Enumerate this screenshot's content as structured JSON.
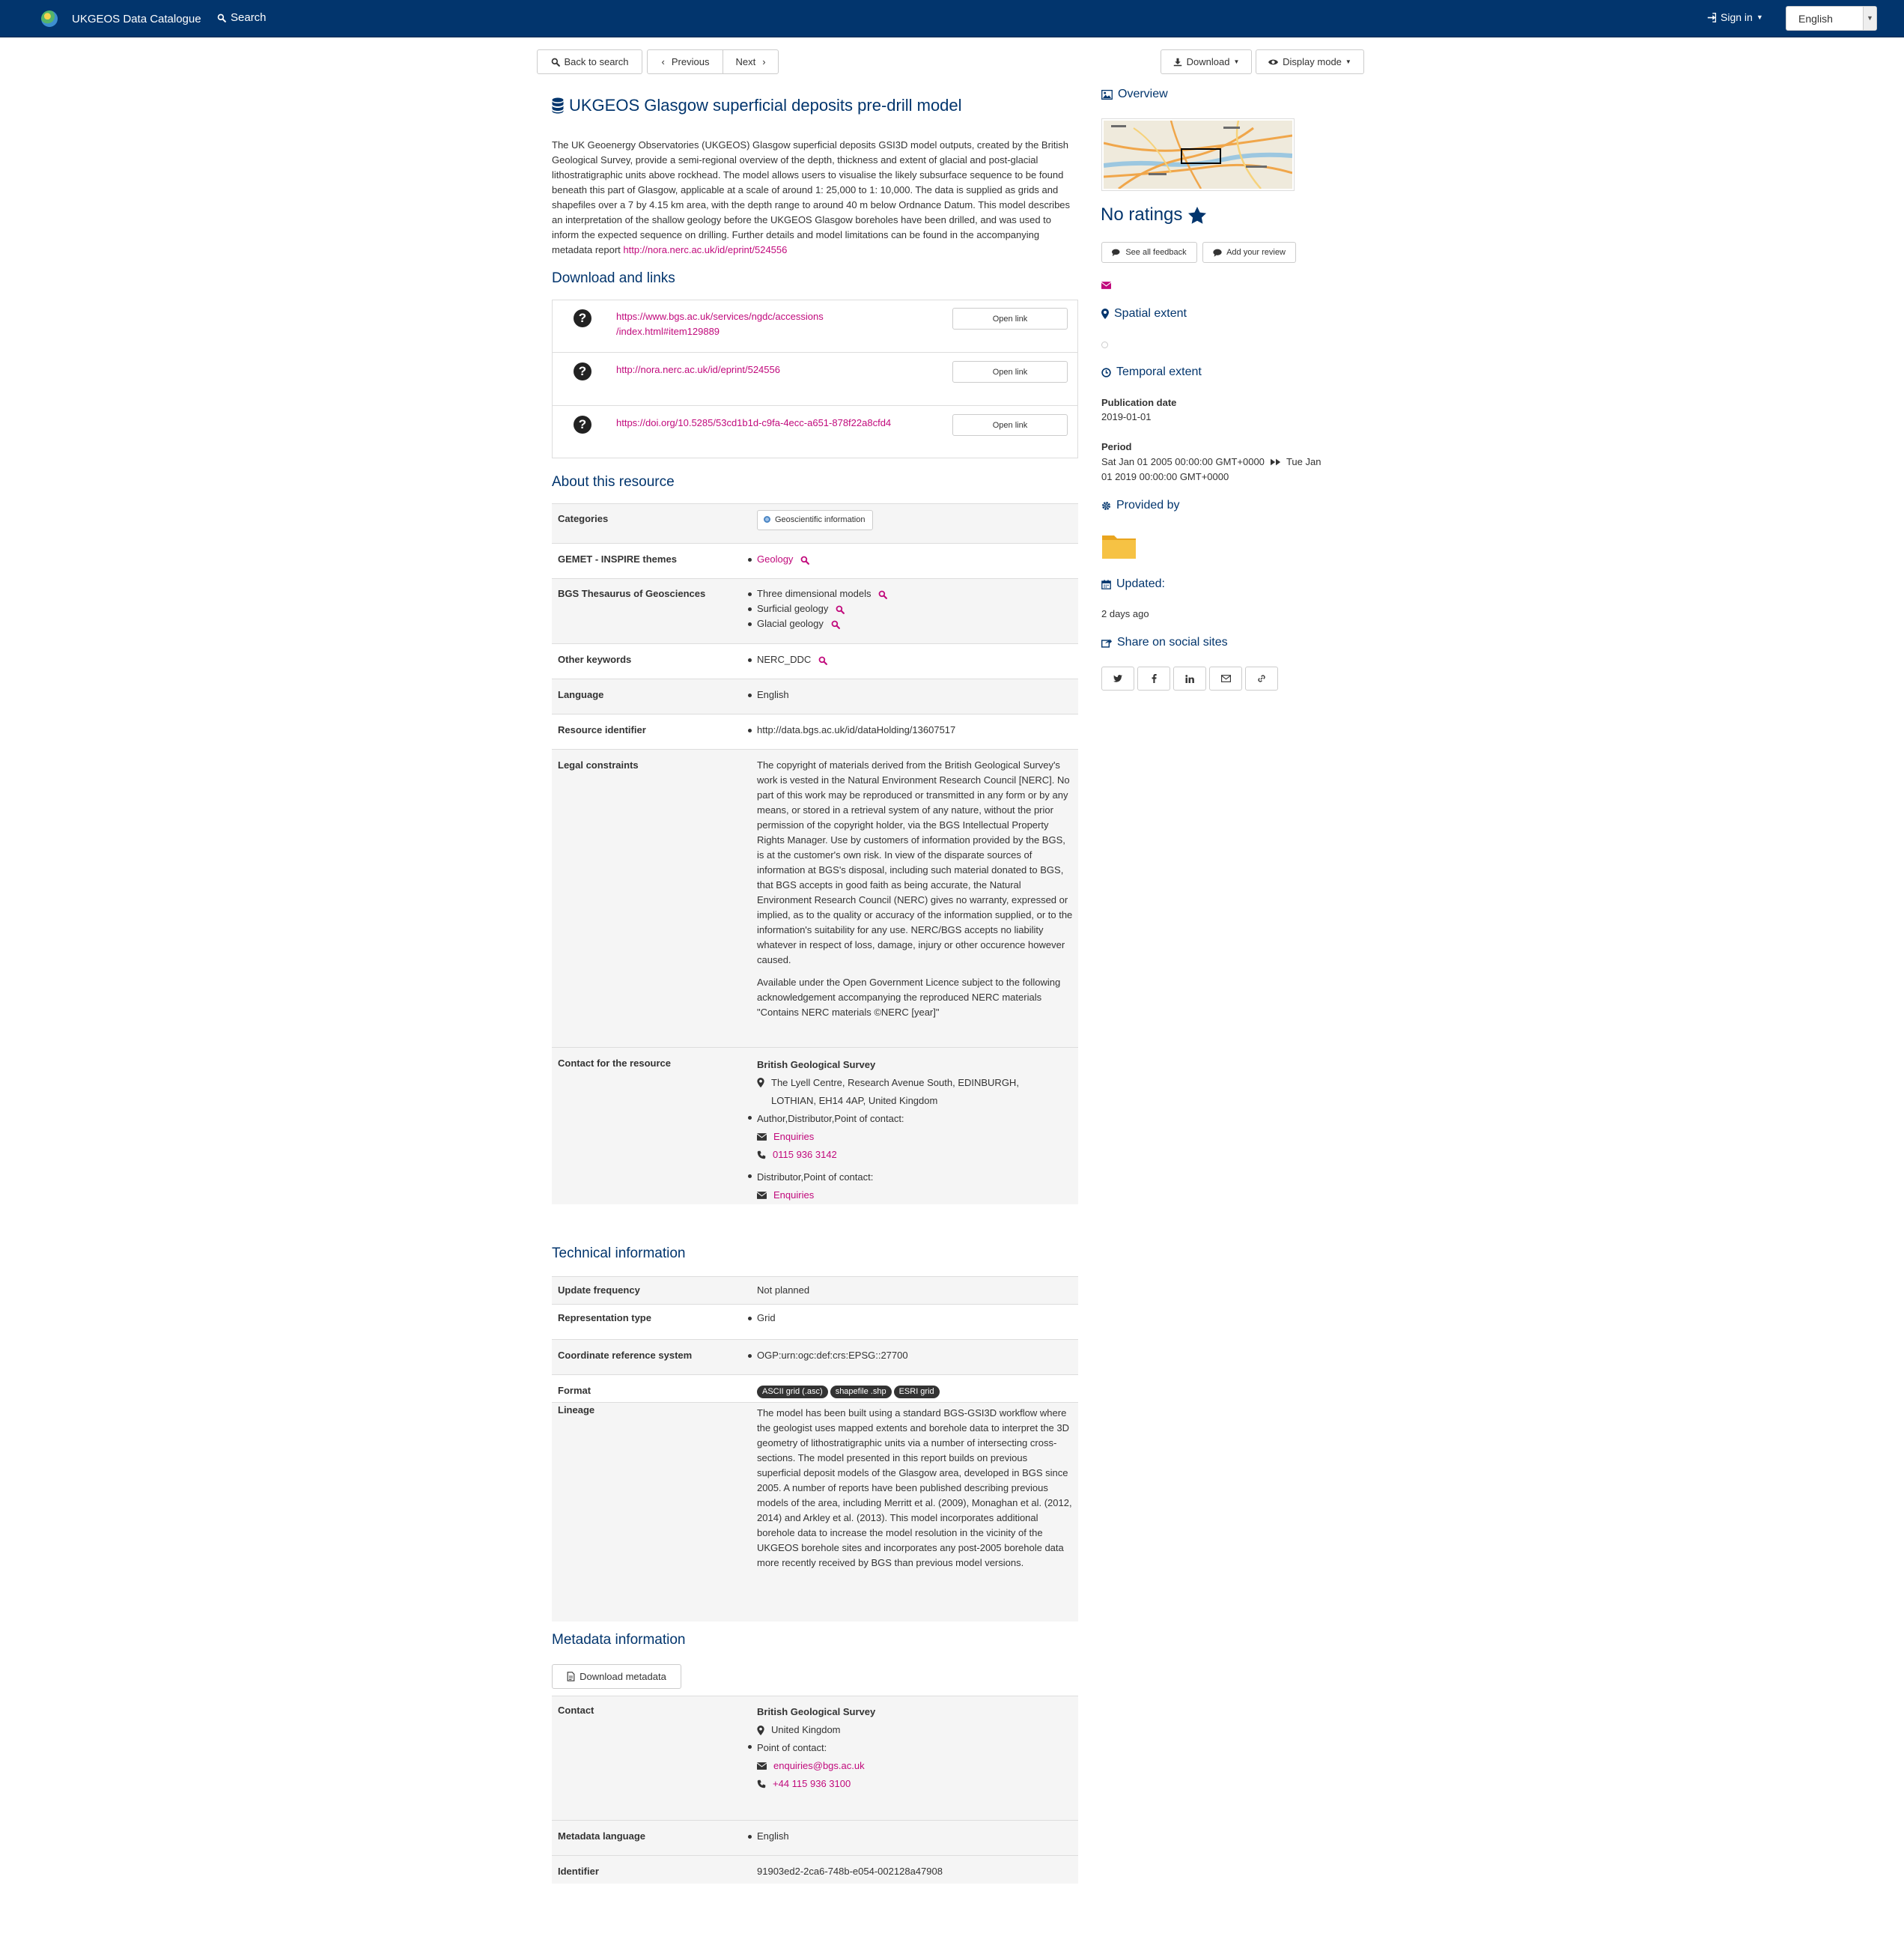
{
  "navbar": {
    "app_title": "UKGEOS Data Catalogue",
    "search_label": "Search",
    "signin_label": "Sign in",
    "language": "English"
  },
  "toolbar": {
    "back_label": "Back to search",
    "previous_label": "Previous",
    "next_label": "Next",
    "download_label": "Download",
    "display_mode_label": "Display mode"
  },
  "record": {
    "title": "UKGEOS Glasgow superficial deposits pre-drill model",
    "abstract": "The UK Geoenergy Observatories (UKGEOS) Glasgow superficial deposits GSI3D model outputs, created by the British Geological Survey, provide a semi-regional overview of the depth, thickness and extent of glacial and post-glacial lithostratigraphic units above rockhead. The model allows users to visualise the likely subsurface sequence to be found beneath this part of Glasgow, applicable at a scale of around 1: 25,000 to 1: 10,000. The data is supplied as grids and shapefiles over a 7 by 4.15 km area, with the depth range to around 40 m below Ordnance Datum. This model describes an interpretation of the shallow geology before the UKGEOS Glasgow boreholes have been drilled, and was used to inform the expected sequence on drilling. Further details and model limitations can be found in the accompanying metadata report ",
    "abstract_link": "http://nora.nerc.ac.uk/id/eprint/524556"
  },
  "downloads": {
    "heading": "Download and links",
    "open_label": "Open link",
    "links": [
      {
        "url_line1": "https://www.bgs.ac.uk/services/ngdc/accessions",
        "url_line2": "/index.html#item129889"
      },
      {
        "url_line1": "http://nora.nerc.ac.uk/id/eprint/524556",
        "url_line2": ""
      },
      {
        "url_line1": "https://doi.org/10.5285/53cd1b1d-c9fa-4ecc-a651-878f22a8cfd4",
        "url_line2": ""
      }
    ]
  },
  "about": {
    "heading": "About this resource",
    "categories_label": "Categories",
    "category": "Geoscientific information",
    "gemet_label": "GEMET - INSPIRE themes",
    "gemet_value": "Geology",
    "bgs_label": "BGS Thesaurus of Geosciences",
    "bgs_values": [
      "Three dimensional models",
      "Surficial geology",
      "Glacial geology"
    ],
    "other_label": "Other keywords",
    "other_value": "NERC_DDC",
    "language_label": "Language",
    "language_value": "English",
    "identifier_label": "Resource identifier",
    "identifier_value": "http://data.bgs.ac.uk/id/dataHolding/13607517",
    "legal_label": "Legal constraints",
    "legal_p1": "The copyright of materials derived from the British Geological Survey's work is vested in the Natural Environment Research Council [NERC]. No part of this work may be reproduced or transmitted in any form or by any means, or stored in a retrieval system of any nature, without the prior permission of the copyright holder, via the BGS Intellectual Property Rights Manager. Use by customers of information provided by the BGS, is at the customer's own risk. In view of the disparate sources of information at BGS's disposal, including such material donated to BGS, that BGS accepts in good faith as being accurate, the Natural Environment Research Council (NERC) gives no warranty, expressed or implied, as to the quality or accuracy of the information supplied, or to the information's suitability for any use. NERC/BGS accepts no liability whatever in respect of loss, damage, injury or other occurence however caused.",
    "legal_p2": "Available under the Open Government Licence subject to the following acknowledgement accompanying the reproduced NERC materials \"Contains NERC materials ©NERC [year]\"",
    "contact_label": "Contact for the resource",
    "contact_org": "British Geological Survey",
    "contact_addr_line1": "The Lyell Centre, Research Avenue South, EDINBURGH,",
    "contact_addr_line2": "LOTHIAN, EH14 4AP, United Kingdom",
    "contact_role1": "Author,Distributor,Point of contact:",
    "contact_email_label": "Enquiries",
    "contact_phone": "0115 936 3142",
    "contact_role2": "Distributor,Point of contact:"
  },
  "technical": {
    "heading": "Technical information",
    "update_label": "Update frequency",
    "update_value": "Not planned",
    "rep_label": "Representation type",
    "rep_value": "Grid",
    "crs_label": "Coordinate reference system",
    "crs_value": "OGP:urn:ogc:def:crs:EPSG::27700",
    "format_label": "Format",
    "formats": [
      "ASCII grid (.asc)",
      "shapefile .shp",
      "ESRI grid"
    ],
    "lineage_label": "Lineage",
    "lineage_value": "The model has been built using a standard BGS-GSI3D workflow where the geologist uses mapped extents and borehole data to interpret the 3D geometry of lithostratigraphic units via a number of intersecting cross-sections. The model presented in this report builds on previous superficial deposit models of the Glasgow area, developed in BGS since 2005. A number of reports have been published describing previous models of the area, including Merritt et al. (2009), Monaghan et al. (2012, 2014) and Arkley et al. (2013). This model incorporates additional borehole data to increase the model resolution in the vicinity of the UKGEOS borehole sites and incorporates any post-2005 borehole data more recently received by BGS than previous model versions."
  },
  "metadata": {
    "heading": "Metadata information",
    "download_label": "Download metadata",
    "contact_label": "Contact",
    "contact_org": "British Geological Survey",
    "contact_country": "United Kingdom",
    "contact_role": "Point of contact:",
    "contact_email": "enquiries@bgs.ac.uk",
    "contact_phone": "+44 115 936 3100",
    "language_label": "Metadata language",
    "language_value": "English",
    "identifier_label": "Identifier",
    "identifier_value": "91903ed2-2ca6-748b-e054-002128a47908"
  },
  "sidebar": {
    "overview_label": "Overview",
    "ratings": "No ratings",
    "see_feedback_label": "See all feedback",
    "add_review_label": "Add your review",
    "spatial_label": "Spatial extent",
    "temporal_label": "Temporal extent",
    "pubdate_label": "Publication date",
    "pubdate_value": "2019-01-01",
    "period_label": "Period",
    "period_start": "Sat Jan 01 2005 00:00:00 GMT+0000",
    "period_end_part1": "Tue Jan",
    "period_end_part2": "01 2019 00:00:00 GMT+0000",
    "provided_label": "Provided by",
    "updated_label": "Updated:",
    "updated_value": "2 days ago",
    "share_label": "Share on social sites",
    "share_icons": [
      "twitter-icon",
      "facebook-icon",
      "linkedin-icon",
      "email-icon",
      "link-icon"
    ]
  },
  "colors": {
    "navbar": "#02356d",
    "heading": "#02356d",
    "link": "#c10a7c"
  }
}
